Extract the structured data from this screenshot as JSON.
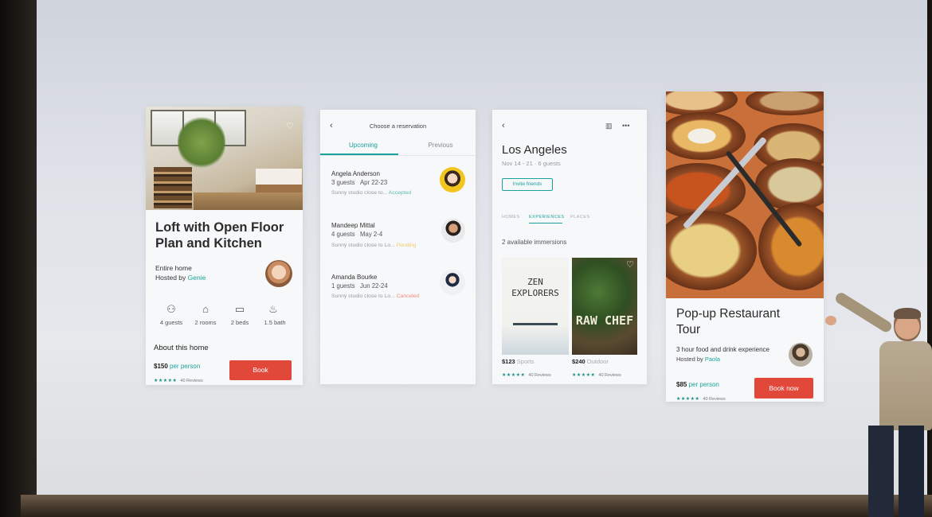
{
  "card1": {
    "title": "Loft with Open Floor Plan and Kitchen",
    "type": "Entire home",
    "hosted_by_prefix": "Hosted by",
    "host": "Genie",
    "amenities": [
      {
        "icon": "guests-icon",
        "label": "4 guests"
      },
      {
        "icon": "door-icon",
        "label": "2 rooms"
      },
      {
        "icon": "bed-icon",
        "label": "2 beds"
      },
      {
        "icon": "bath-icon",
        "label": "1.5 bath"
      }
    ],
    "about": "About this home",
    "price": "$150",
    "price_unit": "per person",
    "reviews": "40 Reviews",
    "book": "Book"
  },
  "card2": {
    "header": "Choose a reservation",
    "tabs": [
      "Upcoming",
      "Previous"
    ],
    "reservations": [
      {
        "name": "Angela Anderson",
        "guests": "3 guests",
        "dates": "Apr 22-23",
        "note": "Sunny studio close to...",
        "status": "Accepted"
      },
      {
        "name": "Mandeep Mittal",
        "guests": "4 guests",
        "dates": "May 2-4",
        "note": "Sunny studio close to Lo...",
        "status": "Pending"
      },
      {
        "name": "Amanda Bourke",
        "guests": "1 guests",
        "dates": "Jun 22-24",
        "note": "Sunny studio close to Lo...",
        "status": "Canceled"
      }
    ],
    "accent": "#1aa39a"
  },
  "card3": {
    "city": "Los Angeles",
    "dates": "Nov 14 - 21 · 6 guests",
    "invite": "Invite friends",
    "tabs": [
      "HOMES",
      "EXPERIENCES",
      "PLACES"
    ],
    "immersions": "2 available immersions",
    "books": [
      {
        "title": "ZEN EXPLORERS",
        "price": "$123",
        "category": "Sports",
        "reviews": "40 Reviews"
      },
      {
        "title": "RAW CHEF",
        "price": "$240",
        "category": "Outdoor",
        "reviews": "40 Reviews"
      }
    ]
  },
  "card4": {
    "title": "Pop-up Restaurant Tour",
    "desc": "3 hour food and drink experience",
    "hosted_by_prefix": "Hosted by",
    "host": "Paola",
    "price": "$85",
    "price_unit": "per person",
    "reviews": "40 Reviews",
    "book": "Book now",
    "button_color": "#e2483a"
  },
  "stars": "★★★★★"
}
